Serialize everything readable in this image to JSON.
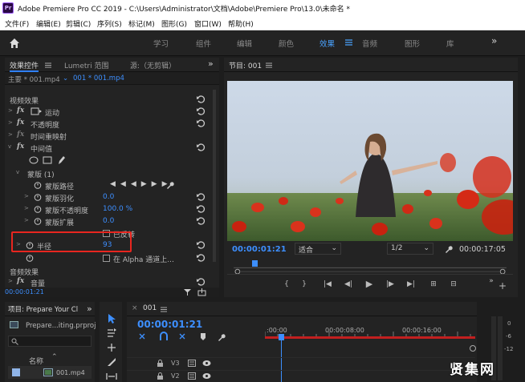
{
  "window": {
    "logo": "Pr",
    "title": "Adobe Premiere Pro CC 2019 - C:\\Users\\Administrator\\文档\\Adobe\\Premiere Pro\\13.0\\未命名 *"
  },
  "menu": [
    "文件(F)",
    "编辑(E)",
    "剪辑(C)",
    "序列(S)",
    "标记(M)",
    "图形(G)",
    "窗口(W)",
    "帮助(H)"
  ],
  "workspaces": {
    "items": [
      "学习",
      "组件",
      "编辑",
      "颜色",
      "效果",
      "音频",
      "图形",
      "库"
    ],
    "active": "效果",
    "more": "»"
  },
  "effect_controls": {
    "tabs": [
      "效果控件",
      "Lumetri 范围",
      "源:（无剪辑）"
    ],
    "more": "»",
    "master": "主要 * 001.mp4",
    "sequence_clip": "001 * 001.mp4",
    "video_effects_header": "视频效果",
    "motion": "运动",
    "opacity": "不透明度",
    "time_remap": "时间重映射",
    "effect_name": "中间值",
    "mask_name": "蒙版 (1)",
    "mask_path": "蒙版路径",
    "mask_feather": "蒙版羽化",
    "mask_feather_value": "0.0",
    "mask_opacity": "蒙版不透明度",
    "mask_opacity_value": "100.0 %",
    "mask_expansion": "蒙版扩展",
    "mask_expansion_value": "0.0",
    "inverted": "已反转",
    "radius": "半径",
    "radius_value": "93",
    "alpha_option": "在 Alpha 通道上...",
    "audio_effects_header": "音频效果",
    "volume": "音量",
    "timecode": "00:00:01:21"
  },
  "program_monitor": {
    "title": "节目: 001",
    "timecode": "00:00:01:21",
    "fit": "适合",
    "resolution": "1/2",
    "duration": "00:00:17:05"
  },
  "project": {
    "title": "项目: Prepare Your Cl",
    "file": "Prepare...iting.prproj",
    "name_col": "名称",
    "item": "001.mp4"
  },
  "timeline": {
    "tab": "001",
    "timecode": "00:00:01:21",
    "ruler": [
      ":00:00",
      "00:00:08:00",
      "00:00:16:00"
    ],
    "tracks": [
      "V3",
      "V2"
    ]
  },
  "vu_scale": [
    "0",
    "-6",
    "-12"
  ],
  "watermark": "贤集网"
}
